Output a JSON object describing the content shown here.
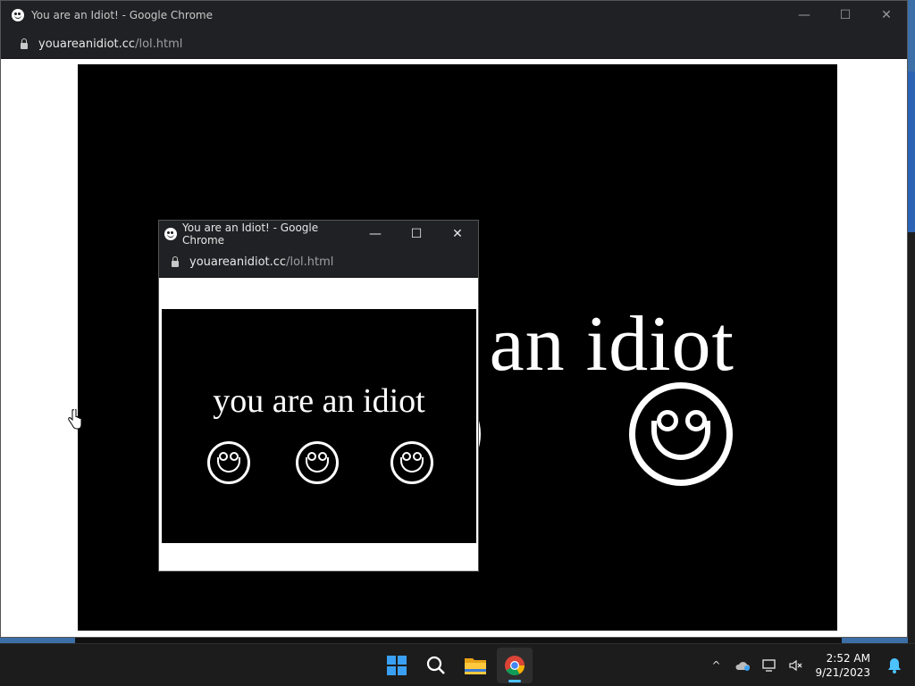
{
  "main_window": {
    "title": "You are an Idiot! - Google Chrome",
    "url_host": "youareanidiot.cc",
    "url_path": "/lol.html",
    "page_text": "an idiot",
    "controls": {
      "minimize": "—",
      "maximize": "☐",
      "close": "✕"
    }
  },
  "popup_window": {
    "title": "You are an Idiot! - Google Chrome",
    "url_host": "youareanidiot.cc",
    "url_path": "/lol.html",
    "page_text": "you are an idiot",
    "controls": {
      "minimize": "—",
      "maximize": "☐",
      "close": "✕"
    }
  },
  "taskbar": {
    "apps": [
      {
        "name": "Start",
        "icon": "windows-start-icon"
      },
      {
        "name": "Search",
        "icon": "search-icon"
      },
      {
        "name": "File Explorer",
        "icon": "folder-icon"
      },
      {
        "name": "Google Chrome",
        "icon": "chrome-icon",
        "active": true
      }
    ],
    "tray": {
      "chevron": "^",
      "time": "2:52 AM",
      "date": "9/21/2023"
    }
  },
  "colors": {
    "titlebar": "#202124",
    "page_background": "#000000",
    "accent": "#4cc2ff"
  }
}
